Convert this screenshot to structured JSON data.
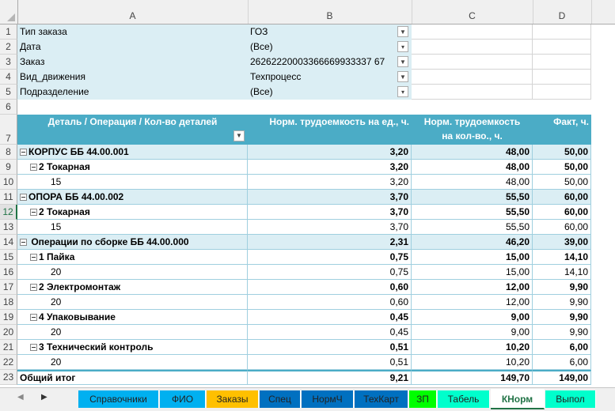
{
  "columns": [
    "A",
    "B",
    "C",
    "D"
  ],
  "filters": [
    {
      "row": "1",
      "label": "Тип заказа",
      "value": "ГОЗ",
      "filtered": true
    },
    {
      "row": "2",
      "label": "Дата",
      "value": "(Все)",
      "filtered": false
    },
    {
      "row": "3",
      "label": "Заказ",
      "value": "26262220003366669933337 67",
      "filtered": true
    },
    {
      "row": "4",
      "label": "Вид_движения",
      "value": "Техпроцесс",
      "filtered": true
    },
    {
      "row": "5",
      "label": "Подразделение",
      "value": "(Все)",
      "filtered": false
    }
  ],
  "blank_row": "6",
  "header": {
    "row": "7",
    "a": "Деталь / Операция / Кол-во деталей",
    "b": "Норм. трудоемкость на ед., ч.",
    "c1": "Норм. трудоемкость",
    "c2": "на кол-во., ч.",
    "d": "Факт, ч."
  },
  "rows": [
    {
      "n": "8",
      "level": 0,
      "label": "КОРПУС ББ 44.00.001",
      "b": "3,20",
      "c": "48,00",
      "d": "50,00"
    },
    {
      "n": "9",
      "level": 1,
      "label": "2 Токарная",
      "b": "3,20",
      "c": "48,00",
      "d": "50,00"
    },
    {
      "n": "10",
      "level": 2,
      "label": "15",
      "b": "3,20",
      "c": "48,00",
      "d": "50,00"
    },
    {
      "n": "11",
      "level": 0,
      "label": "ОПОРА ББ 44.00.002",
      "b": "3,70",
      "c": "55,50",
      "d": "60,00"
    },
    {
      "n": "12",
      "level": 1,
      "label": "2 Токарная",
      "b": "3,70",
      "c": "55,50",
      "d": "60,00"
    },
    {
      "n": "13",
      "level": 2,
      "label": "15",
      "b": "3,70",
      "c": "55,50",
      "d": "60,00"
    },
    {
      "n": "14",
      "level": 0,
      "label": " Операции по сборке ББ 44.00.000",
      "b": "2,31",
      "c": "46,20",
      "d": "39,00"
    },
    {
      "n": "15",
      "level": 1,
      "label": "1 Пайка",
      "b": "0,75",
      "c": "15,00",
      "d": "14,10"
    },
    {
      "n": "16",
      "level": 2,
      "label": "20",
      "b": "0,75",
      "c": "15,00",
      "d": "14,10"
    },
    {
      "n": "17",
      "level": 1,
      "label": "2 Электромонтаж",
      "b": "0,60",
      "c": "12,00",
      "d": "9,90"
    },
    {
      "n": "18",
      "level": 2,
      "label": "20",
      "b": "0,60",
      "c": "12,00",
      "d": "9,90"
    },
    {
      "n": "19",
      "level": 1,
      "label": "4 Упаковывание",
      "b": "0,45",
      "c": "9,00",
      "d": "9,90"
    },
    {
      "n": "20",
      "level": 2,
      "label": "20",
      "b": "0,45",
      "c": "9,00",
      "d": "9,90"
    },
    {
      "n": "21",
      "level": 1,
      "label": "3 Технический контроль",
      "b": "0,51",
      "c": "10,20",
      "d": "6,00"
    },
    {
      "n": "22",
      "level": 2,
      "label": "20",
      "b": "0,51",
      "c": "10,20",
      "d": "6,00"
    },
    {
      "n": "23",
      "level": -1,
      "label": "Общий итог",
      "b": "9,21",
      "c": "149,70",
      "d": "149,00"
    }
  ],
  "tabs": [
    {
      "label": "Справочники",
      "color": "#00b0f0"
    },
    {
      "label": "ФИО",
      "color": "#00b0f0"
    },
    {
      "label": "Заказы",
      "color": "#ffc000"
    },
    {
      "label": "Спец",
      "color": "#0070c0"
    },
    {
      "label": "НормЧ",
      "color": "#0070c0"
    },
    {
      "label": "ТехКарт",
      "color": "#0070c0"
    },
    {
      "label": "ЗП",
      "color": "#00ff00"
    },
    {
      "label": "Табель",
      "color": "#00ffcc"
    },
    {
      "label": "КНорм",
      "color": "#ffffff",
      "active": true
    },
    {
      "label": "Выпол",
      "color": "#00ffcc"
    }
  ]
}
